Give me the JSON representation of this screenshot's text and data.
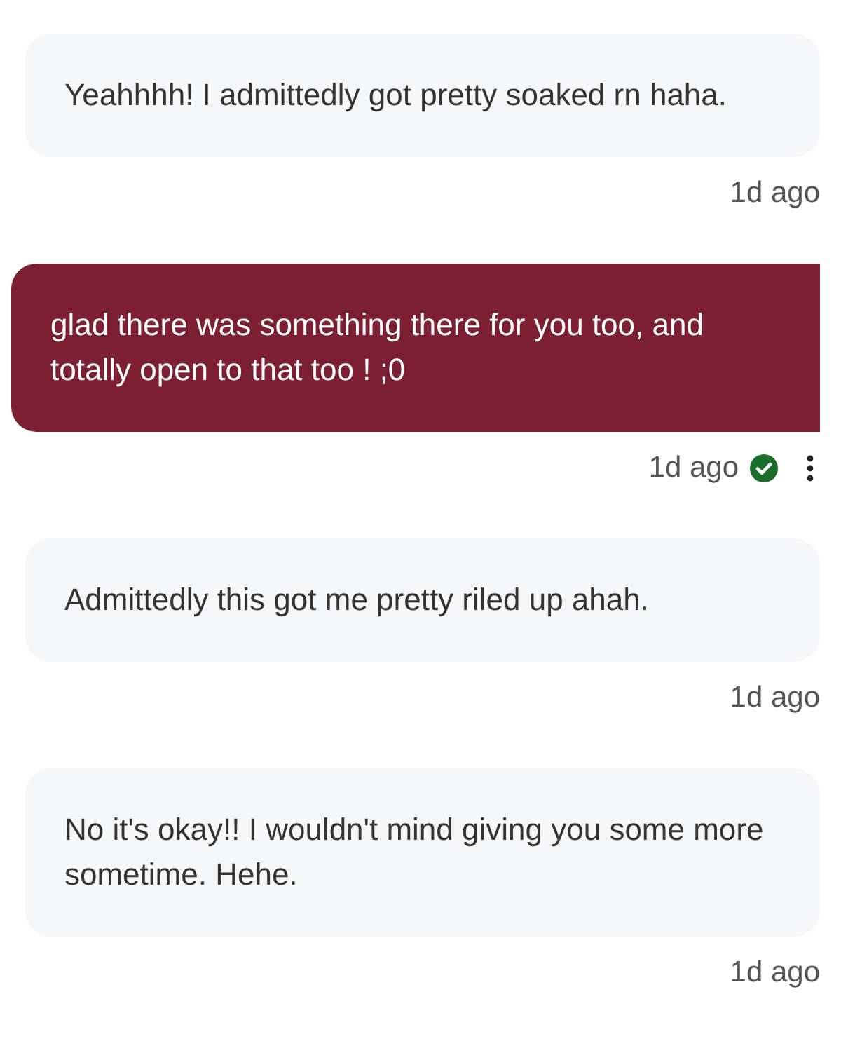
{
  "messages": [
    {
      "kind": "received",
      "text": "Yeahhhh! I admittedly got pretty soaked rn haha.",
      "time": "1d ago"
    },
    {
      "kind": "sent",
      "text": "glad there was something there for you too, and totally open to that too ! ;0",
      "time": "1d ago",
      "read": true
    },
    {
      "kind": "received",
      "text": "Admittedly this got me pretty riled up ahah.",
      "time": "1d ago"
    },
    {
      "kind": "received",
      "text": "No it's okay!! I wouldn't mind giving you some more sometime. Hehe.",
      "time": "1d ago"
    }
  ]
}
